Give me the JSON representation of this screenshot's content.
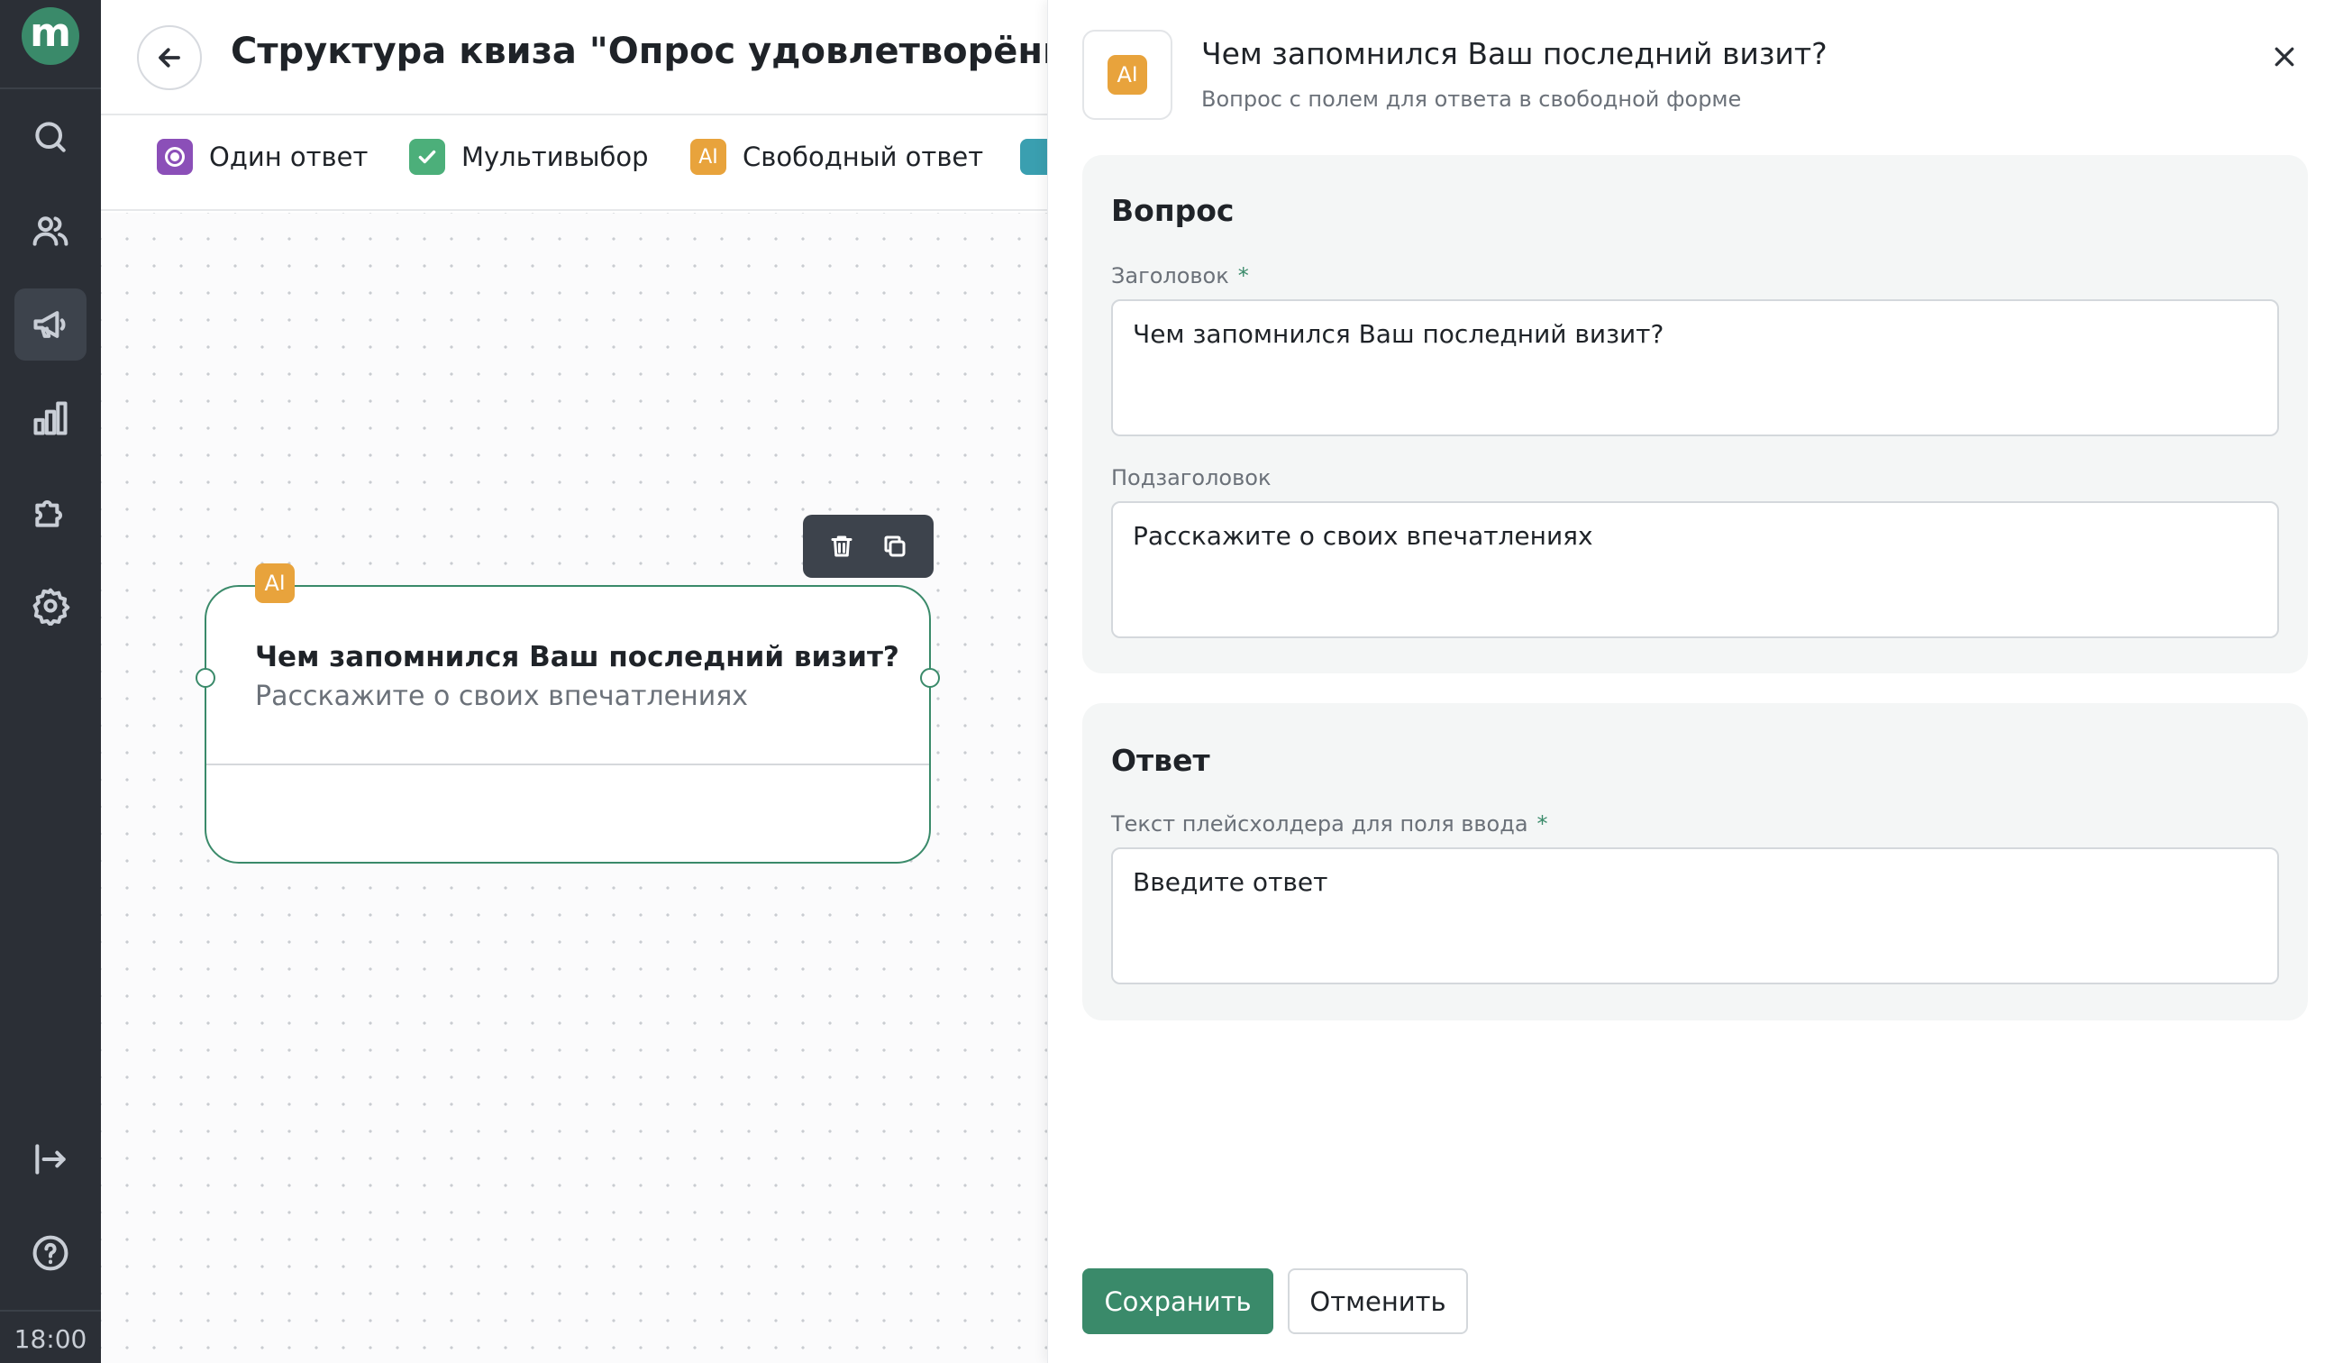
{
  "app": {
    "logo_letter": "m",
    "time": "18:00"
  },
  "rail": {
    "items": [
      {
        "icon": "search-icon"
      },
      {
        "icon": "users-icon"
      },
      {
        "icon": "megaphone-icon",
        "active": true
      },
      {
        "icon": "bar-chart-icon"
      },
      {
        "icon": "puzzle-icon"
      },
      {
        "icon": "gear-icon"
      }
    ],
    "bottom": [
      {
        "icon": "logout-icon"
      },
      {
        "icon": "help-icon"
      }
    ]
  },
  "header": {
    "title": "Структура квиза \"Опрос удовлетворённости"
  },
  "question_types": [
    {
      "label": "Один ответ",
      "color": "#8b4fb8",
      "icon": "radio-icon"
    },
    {
      "label": "Мультивыбор",
      "color": "#4caf7a",
      "icon": "check-icon"
    },
    {
      "label": "Свободный ответ",
      "color": "#e8a33c",
      "icon": "text-cursor-icon"
    }
  ],
  "node": {
    "title": "Чем запомнился Ваш последний визит?",
    "subtitle": "Расскажите о своих впечатлениях",
    "badge": "A",
    "border_color": "#3a8a6a"
  },
  "panel": {
    "title": "Чем запомнился Ваш последний визит?",
    "subtitle": "Вопрос с полем для ответа в свободной форме",
    "sections": {
      "question": {
        "title": "Вопрос",
        "heading_label": "Заголовок",
        "heading_value": "Чем запомнился Ваш последний визит?",
        "subheading_label": "Подзаголовок",
        "subheading_value": "Расскажите о своих впечатлениях"
      },
      "answer": {
        "title": "Ответ",
        "placeholder_label": "Текст плейсхолдера для поля ввода",
        "placeholder_value": "Введите ответ"
      }
    },
    "required_mark": "*",
    "save_label": "Сохранить",
    "cancel_label": "Отменить"
  },
  "colors": {
    "accent": "#3a8a6a",
    "rail_bg": "#2b2f36",
    "free_answer": "#e8a33c"
  }
}
